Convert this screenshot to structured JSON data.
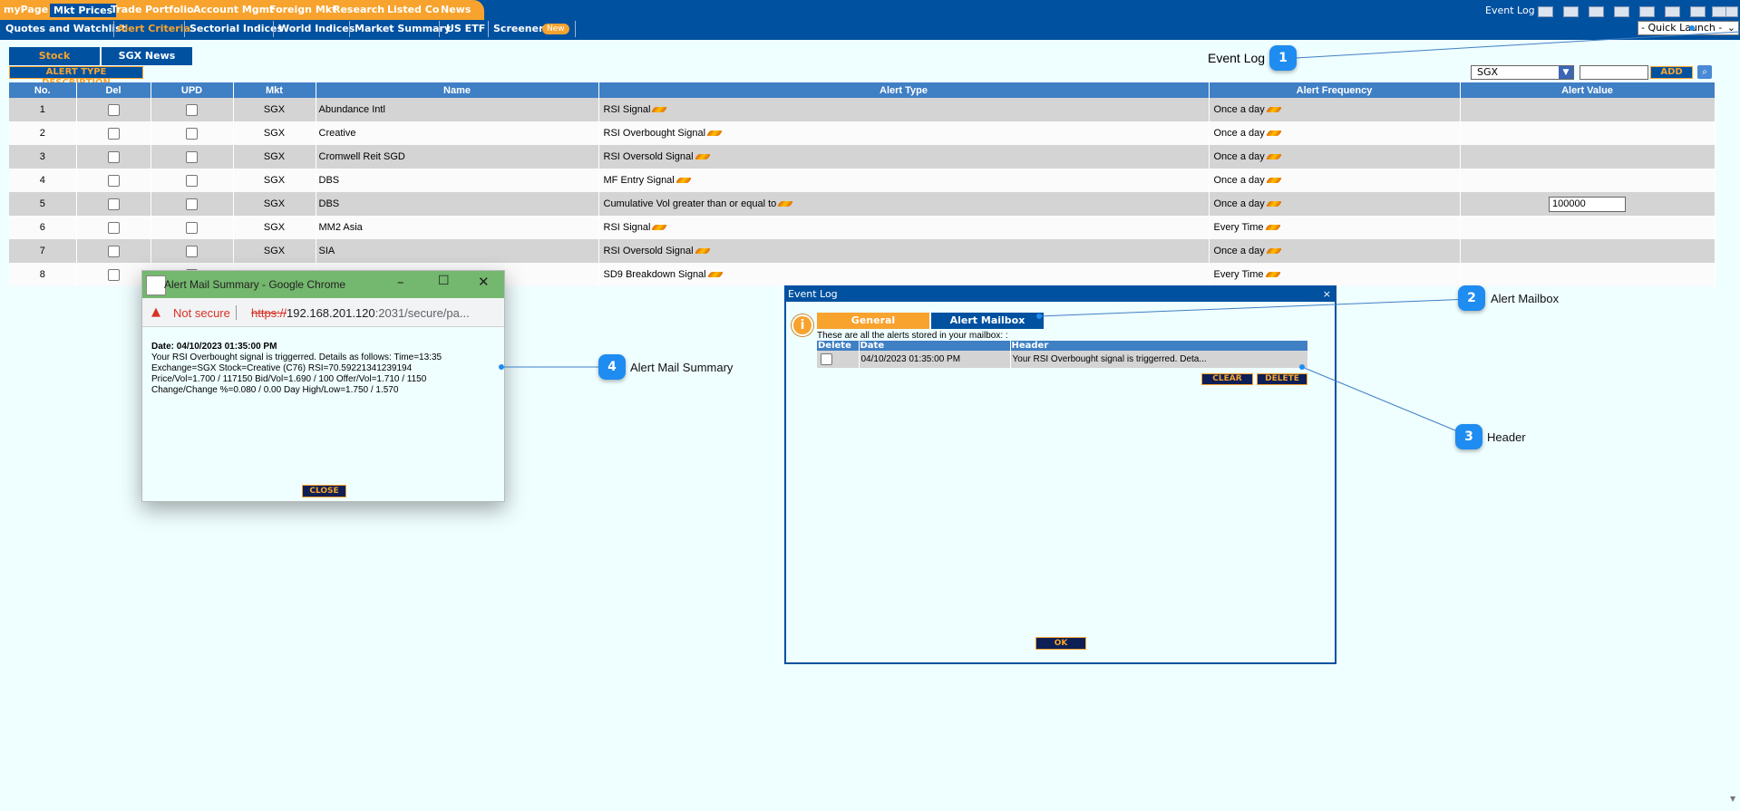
{
  "top_nav": {
    "items": [
      "myPage",
      "Mkt Prices",
      "Trade",
      "Portfolio",
      "Account Mgmt",
      "Foreign Mkt",
      "Research",
      "Listed Co",
      "News"
    ],
    "active": "Mkt Prices",
    "right_link": "Event Log",
    "toolbar_icons": [
      "list-icon",
      "folder-add-icon",
      "edit-icon",
      "grid-add-icon",
      "layout-icon",
      "columns-icon",
      "window-icon",
      "printer-icon",
      "logout-icon"
    ]
  },
  "sub_nav": {
    "items": [
      "Quotes and Watchlist",
      "Alert Criteria",
      "Sectorial Indices",
      "World Indices",
      "Market Summary",
      "US ETF",
      "Screener"
    ],
    "active": "Alert Criteria",
    "new_badge": "New",
    "quick_launch": "- Quick Launch -"
  },
  "tabs": {
    "stock": "Stock",
    "sgx_news": "SGX News"
  },
  "alert_type_description": "ALERT TYPE DESCRIPTION",
  "exchange_select": "SGX",
  "add_label": "ADD",
  "table": {
    "headers": [
      "No.",
      "Del",
      "UPD",
      "Mkt",
      "Name",
      "Alert Type",
      "Alert Frequency",
      "Alert Value"
    ],
    "rows": [
      {
        "no": "1",
        "mkt": "SGX",
        "name": "Abundance Intl",
        "alert_type": "RSI Signal",
        "freq": "Once a day",
        "value": ""
      },
      {
        "no": "2",
        "mkt": "SGX",
        "name": "Creative",
        "alert_type": "RSI Overbought Signal",
        "freq": "Once a day",
        "value": ""
      },
      {
        "no": "3",
        "mkt": "SGX",
        "name": "Cromwell Reit SGD",
        "alert_type": "RSI Oversold Signal",
        "freq": "Once a day",
        "value": ""
      },
      {
        "no": "4",
        "mkt": "SGX",
        "name": "DBS",
        "alert_type": "MF Entry Signal",
        "freq": "Once a day",
        "value": ""
      },
      {
        "no": "5",
        "mkt": "SGX",
        "name": "DBS",
        "alert_type": "Cumulative Vol greater than or equal to",
        "freq": "Once a day",
        "value": "100000"
      },
      {
        "no": "6",
        "mkt": "SGX",
        "name": "MM2 Asia",
        "alert_type": "RSI Signal",
        "freq": "Every Time",
        "value": ""
      },
      {
        "no": "7",
        "mkt": "SGX",
        "name": "SIA",
        "alert_type": "RSI Oversold Signal",
        "freq": "Once a day",
        "value": ""
      },
      {
        "no": "8",
        "mkt": "",
        "name": "",
        "alert_type": "SD9 Breakdown Signal",
        "freq": "Every Time",
        "value": ""
      }
    ]
  },
  "popup": {
    "title": "Alert Mail Summary - Google Chrome",
    "not_secure": "Not secure",
    "url_scheme": "https://",
    "url_host": "192.168.201.120",
    "url_rest": ":2031/secure/pa...",
    "date_line": "Date:  04/10/2023 01:35:00 PM",
    "body_lines": [
      "Your RSI Overbought signal is triggerred. Details as follows: Time=13:35",
      "Exchange=SGX Stock=Creative (C76) RSI=70.59221341239194",
      "Price/Vol=1.700 / 117150 Bid/Vol=1.690 / 100 Offer/Vol=1.710 / 1150",
      "Change/Change %=0.080 / 0.00 Day High/Low=1.750 / 1.570"
    ],
    "close_label": "CLOSE"
  },
  "event_log": {
    "title": "Event Log",
    "close_x": "×",
    "tab_general": "General",
    "tab_mailbox": "Alert Mailbox",
    "description": "These are all the alerts stored in your mailbox: :",
    "headers": [
      "Delete",
      "Date",
      "Header"
    ],
    "rows": [
      {
        "date": "04/10/2023 01:35:00 PM",
        "header": "Your RSI Overbought signal is triggerred. Deta..."
      }
    ],
    "clear_label": "CLEAR",
    "delete_label": "DELETE",
    "ok_label": "OK"
  },
  "page_event_log_label": "Event Log",
  "callouts": [
    {
      "num": "1",
      "label": "Event Log"
    },
    {
      "num": "2",
      "label": "Alert Mailbox"
    },
    {
      "num": "3",
      "label": "Header"
    },
    {
      "num": "4",
      "label": "Alert Mail Summary"
    }
  ],
  "colors": {
    "nav_blue": "#0051a0",
    "nav_orange": "#f7a32e",
    "header_blue": "#3f7fc4",
    "page_bg": "#effeff",
    "callout_blue": "#1e8cf0"
  }
}
